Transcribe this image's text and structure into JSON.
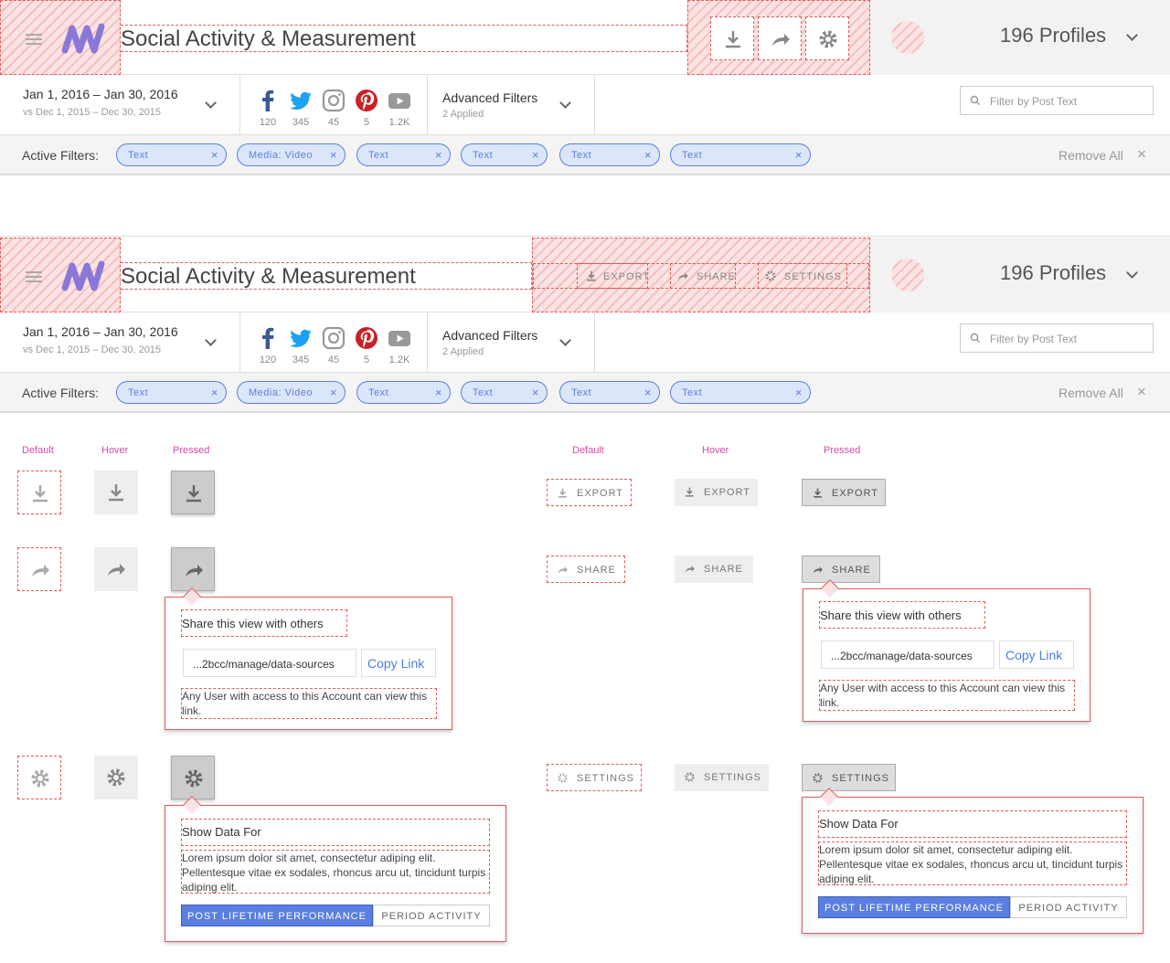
{
  "header": {
    "title": "Social Activity & Measurement",
    "profiles": "196 Profiles"
  },
  "toolbar_labels": {
    "export": "EXPORT",
    "share": "SHARE",
    "settings": "SETTINGS"
  },
  "date": {
    "range": "Jan 1, 2016 – Jan 30, 2016",
    "compare": "vs Dec 1, 2015 – Dec 30, 2015"
  },
  "social": {
    "facebook": "120",
    "twitter": "345",
    "instagram": "45",
    "pinterest": "5",
    "youtube": "1.2K"
  },
  "advanced": {
    "label": "Advanced Filters",
    "applied": "2 Applied"
  },
  "search": {
    "placeholder": "Filter by Post Text"
  },
  "filters": {
    "label": "Active Filters:",
    "chips": [
      "Text",
      "Media: Video",
      "Text",
      "Text",
      "Text",
      "Text"
    ],
    "remove_all": "Remove All",
    "close": "×"
  },
  "states": {
    "default": "Default",
    "hover": "Hover",
    "pressed": "Pressed"
  },
  "share_popover": {
    "title": "Share this view with others",
    "url": "...2bcc/manage/data-sources",
    "copy": "Copy Link",
    "note": "Any User with access to this Account can view this link."
  },
  "settings_popover": {
    "title": "Show Data For",
    "body": "Lorem ipsum dolor sit amet, consectetur adiping elit. Pellentesque vitae ex sodales, rhoncus arcu ut, tincidunt turpis adiping elit.",
    "opt_on": "POST LIFETIME PERFORMANCE",
    "opt_off": "PERIOD ACTIVITY"
  },
  "colors": {
    "accent": "#5b7fe0",
    "annotation": "#e35a5a",
    "state_label": "#d44ba8"
  }
}
